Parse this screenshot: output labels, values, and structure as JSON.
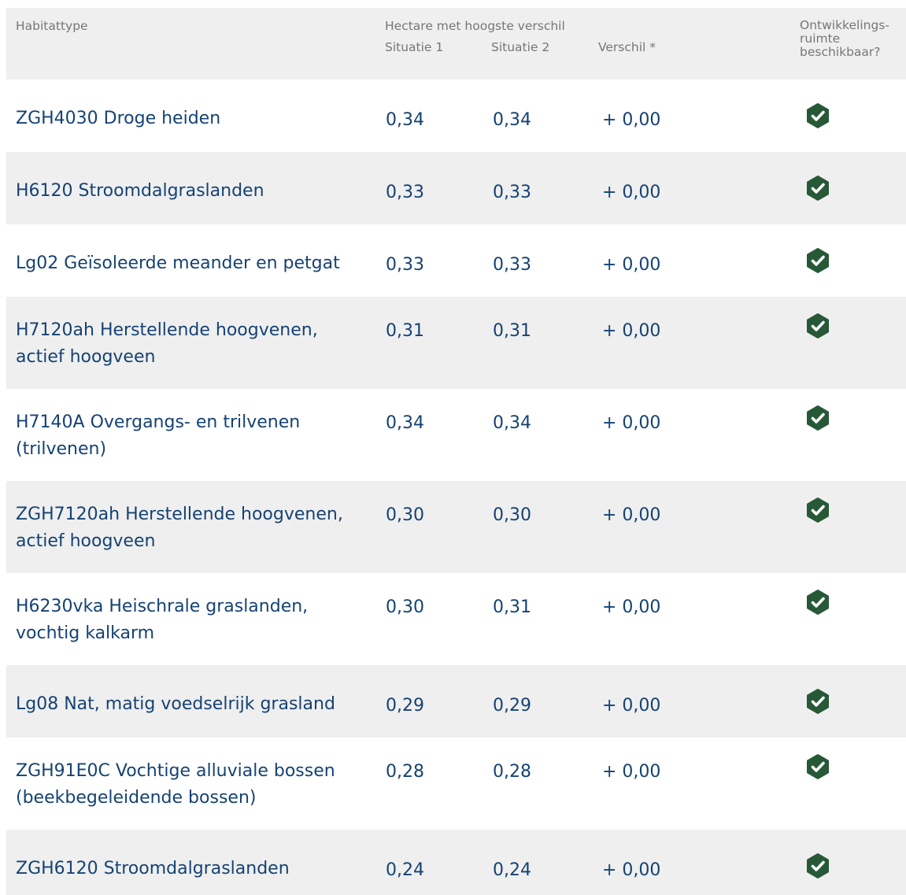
{
  "header": {
    "habitat_type": "Habitattype",
    "group": "Hectare met hoogste verschil",
    "situatie1": "Situatie 1",
    "situatie2": "Situatie 2",
    "verschil": "Verschil *",
    "space": "Ontwikkelings-ruimte beschikbaar?"
  },
  "rows": [
    {
      "name": "ZGH4030 Droge heiden",
      "s1": "0,34",
      "s2": "0,34",
      "diff": "+ 0,00",
      "available": true
    },
    {
      "name": "H6120 Stroomdalgraslanden",
      "s1": "0,33",
      "s2": "0,33",
      "diff": "+ 0,00",
      "available": true
    },
    {
      "name": "Lg02 Geïsoleerde meander en petgat",
      "s1": "0,33",
      "s2": "0,33",
      "diff": "+ 0,00",
      "available": true
    },
    {
      "name": "H7120ah Herstellende hoogvenen, actief hoogveen",
      "s1": "0,31",
      "s2": "0,31",
      "diff": "+ 0,00",
      "available": true
    },
    {
      "name": "H7140A Overgangs- en trilvenen (trilvenen)",
      "s1": "0,34",
      "s2": "0,34",
      "diff": "+ 0,00",
      "available": true
    },
    {
      "name": "ZGH7120ah Herstellende hoogvenen, actief hoogveen",
      "s1": "0,30",
      "s2": "0,30",
      "diff": "+ 0,00",
      "available": true
    },
    {
      "name": "H6230vka Heischrale graslanden, vochtig kalkarm",
      "s1": "0,30",
      "s2": "0,31",
      "diff": "+ 0,00",
      "available": true
    },
    {
      "name": "Lg08 Nat, matig voedselrijk grasland",
      "s1": "0,29",
      "s2": "0,29",
      "diff": "+ 0,00",
      "available": true
    },
    {
      "name": "ZGH91E0C Vochtige alluviale bossen (beekbegeleidende bossen)",
      "s1": "0,28",
      "s2": "0,28",
      "diff": "+ 0,00",
      "available": true
    },
    {
      "name": "ZGH6120 Stroomdalgraslanden",
      "s1": "0,24",
      "s2": "0,24",
      "diff": "+ 0,00",
      "available": true
    }
  ],
  "colors": {
    "text": "#154273",
    "header_text": "#767676",
    "stripe": "#efefef",
    "check": "#275937"
  },
  "icons": {
    "available": "check-hexagon-icon"
  }
}
